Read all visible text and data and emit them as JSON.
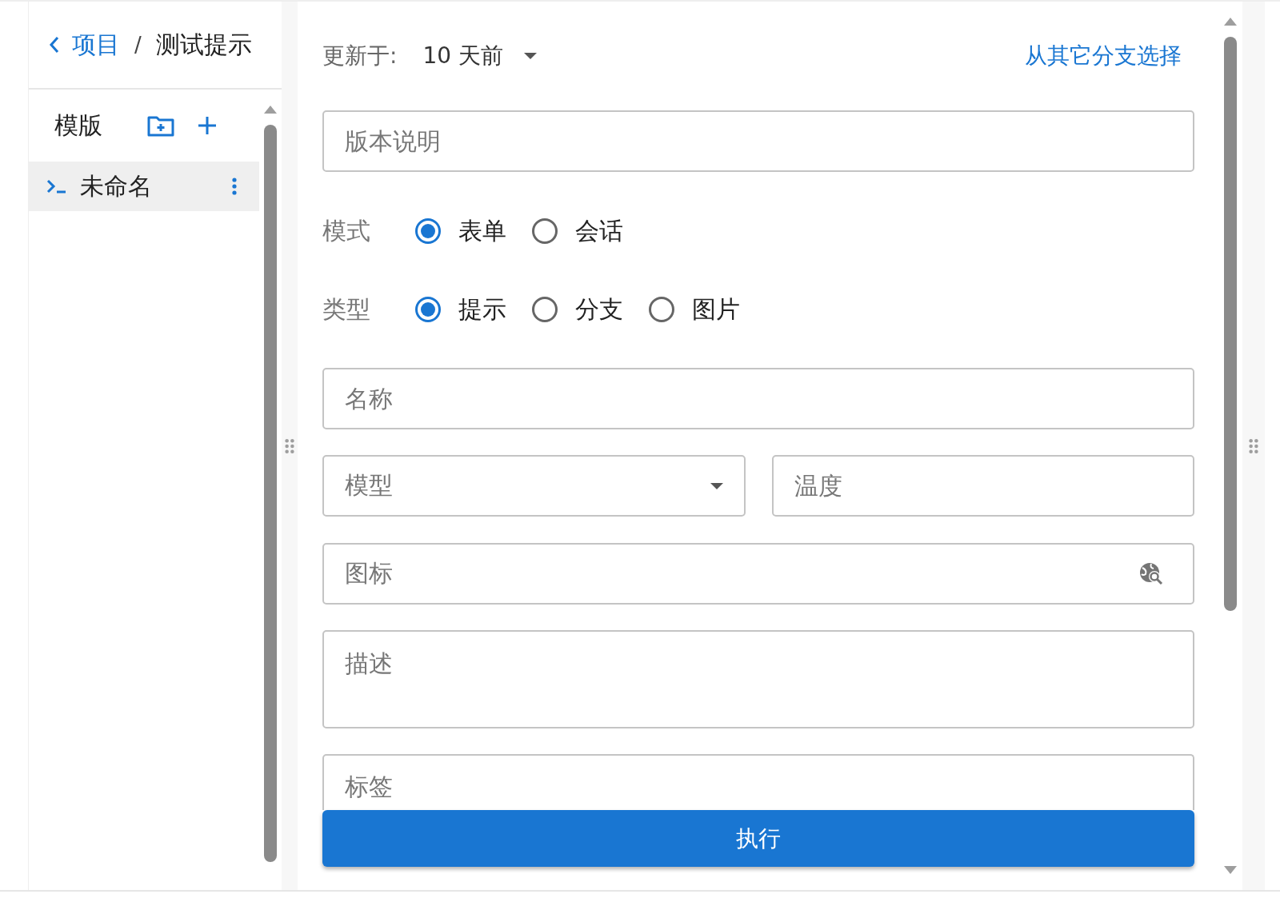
{
  "breadcrumb": {
    "back": "项目",
    "separator": "/",
    "current": "测试提示"
  },
  "sidebar": {
    "title": "模版",
    "items": [
      {
        "label": "未命名",
        "selected": true
      }
    ]
  },
  "header": {
    "updated_label": "更新于:",
    "updated_value": "10 天前",
    "branch_link": "从其它分支选择"
  },
  "form": {
    "version_note": {
      "placeholder": "版本说明"
    },
    "radio_groups": [
      {
        "label": "模式",
        "options": [
          {
            "label": "表单",
            "selected": true
          },
          {
            "label": "会话",
            "selected": false
          }
        ]
      },
      {
        "label": "类型",
        "options": [
          {
            "label": "提示",
            "selected": true
          },
          {
            "label": "分支",
            "selected": false
          },
          {
            "label": "图片",
            "selected": false
          }
        ]
      }
    ],
    "name": {
      "placeholder": "名称"
    },
    "model": {
      "placeholder": "模型"
    },
    "temperature": {
      "placeholder": "温度"
    },
    "icon": {
      "placeholder": "图标"
    },
    "description": {
      "placeholder": "描述"
    },
    "tags": {
      "placeholder": "标签"
    }
  },
  "run_button": "执行"
}
